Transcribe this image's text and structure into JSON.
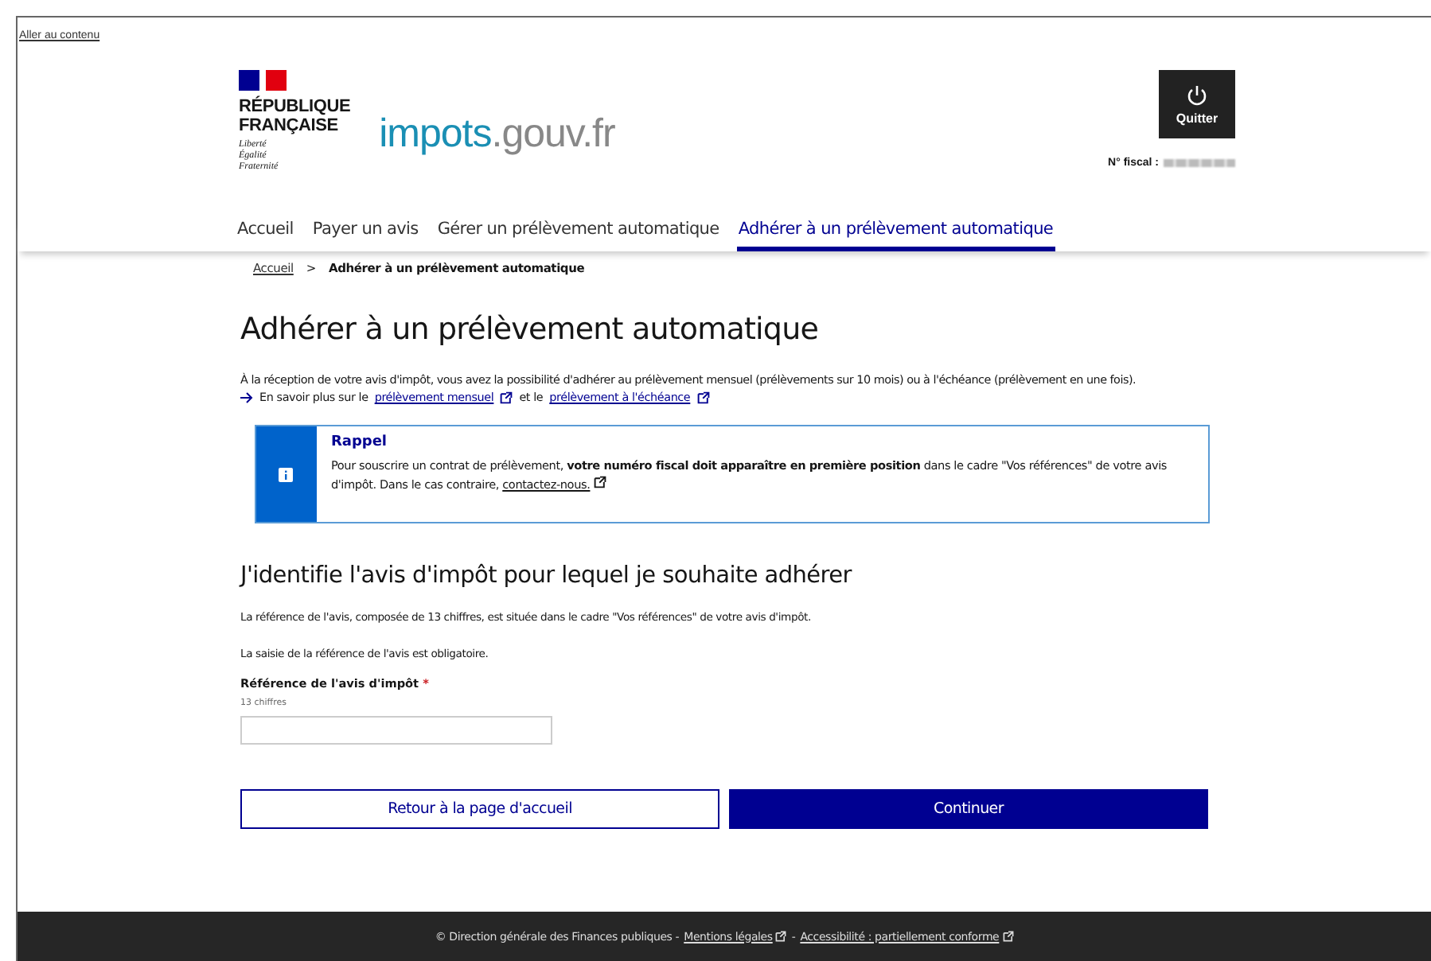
{
  "skip_link": "Aller au contenu",
  "header": {
    "republique": "RÉPUBLIQUE\nFRANÇAISE",
    "devise": [
      "Liberté",
      "Égalité",
      "Fraternité"
    ],
    "site_name": "impots",
    "site_domain": ".gouv.fr",
    "logout": "Quitter",
    "fiscal_label": "N° fiscal :"
  },
  "nav": [
    {
      "label": "Accueil",
      "selected": false
    },
    {
      "label": "Payer un avis",
      "selected": false
    },
    {
      "label": "Gérer un prélèvement automatique",
      "selected": false
    },
    {
      "label": "Adhérer à un prélèvement automatique",
      "selected": true
    }
  ],
  "breadcrumb": {
    "home": "Accueil",
    "separator": ">",
    "current": "Adhérer à un prélèvement automatique"
  },
  "title": "Adhérer à un prélèvement automatique",
  "intro": "À la réception de votre avis d'impôt, vous avez la possibilité d'adhérer au prélèvement mensuel (prélèvements sur 10 mois) ou à l'échéance (prélèvement en une fois).",
  "learn_more": {
    "prefix": "En savoir plus sur le",
    "link1": "prélèvement mensuel",
    "middle": "et le",
    "link2": "prélèvement à l'échéance"
  },
  "callout": {
    "title": "Rappel",
    "text": "Pour souscrire un contrat de prélèvement, **votre numéro fiscal doit apparaître en première position** dans le cadre \"Vos références\" de votre avis d'impôt. Dans le cas contraire,",
    "link": "contactez-nous."
  },
  "section_title": "J'identifie l'avis d'impôt pour lequel je souhaite adhérer",
  "paragraphs": [
    "La référence de l'avis, composée de 13 chiffres, est située dans le cadre \"Vos références\" de votre avis d'impôt.",
    "La saisie de la référence de l'avis est obligatoire."
  ],
  "field": {
    "label": "Référence de l'avis d'impôt",
    "required": "*",
    "hint": "13 chiffres"
  },
  "buttons": [
    {
      "label": "Retour à la page d'accueil",
      "kind": "secondary"
    },
    {
      "label": "Continuer",
      "kind": "primary"
    }
  ],
  "footer": {
    "text": "© Direction générale des Finances publiques -",
    "link1": "Mentions légales",
    "sep": "-",
    "link2": "Accessibilité : partiellement conforme"
  }
}
